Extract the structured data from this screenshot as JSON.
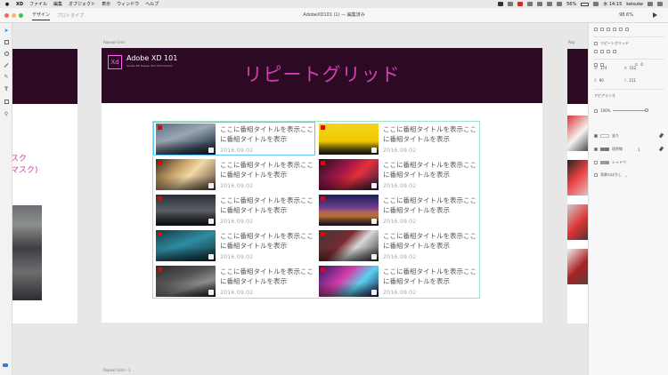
{
  "menubar": {
    "items": [
      "XD",
      "ファイル",
      "編集",
      "オブジェクト",
      "表示",
      "ウィンドウ",
      "ヘルプ"
    ],
    "battery": "56%",
    "clock": "水 14:15",
    "user": "keisuke"
  },
  "titlebar": {
    "tab_design": "デザイン",
    "tab_prototype": "プロトタイプ",
    "doc_title": "AdobeXD101 (1) — 編集済み",
    "zoom": "98.6%"
  },
  "canvas": {
    "label_main": "Repeat Grid",
    "label_right": "Rep",
    "label_bottom": "Repeat Grid – 1",
    "left_artboard_line1": "スク",
    "left_artboard_line2": "マスク)"
  },
  "artboard": {
    "logo": "Xd",
    "course_title": "Adobe XD 101",
    "course_subtitle": "Adobe XD Design Tool Introduction",
    "heading": "リピートグリッド"
  },
  "grid": {
    "items": [
      {
        "title": "ここに番組タイトルを表示ここに番組タイトルを表示",
        "date": "2016.09.02",
        "bg": "linear-gradient(160deg,#5d6d80 0%,#9aa6b3 40%,#3b4a5c 75%,#1f2833 100%)"
      },
      {
        "title": "ここに番組タイトルを表示ここに番組タイトルを表示",
        "date": "2016.09.02",
        "bg": "linear-gradient(180deg,#f5d51c 0%,#f0c800 60%,#222 100%)"
      },
      {
        "title": "ここに番組タイトルを表示ここに番組タイトルを表示",
        "date": "2016.09.02",
        "bg": "linear-gradient(135deg,#3a2a1f 0%,#c7a067 35%,#f1d9a8 55%,#5a4030 100%)"
      },
      {
        "title": "ここに番組タイトルを表示ここに番組タイトルを表示",
        "date": "2016.09.02",
        "bg": "linear-gradient(135deg,#1c1224 0%,#a4174a 40%,#e52f3a 60%,#26224a 100%)"
      },
      {
        "title": "ここに番組タイトルを表示ここに番組タイトルを表示",
        "date": "2016.09.02",
        "bg": "linear-gradient(180deg,#2a2d33 0%,#5a5e66 50%,#1b1c20 100%)"
      },
      {
        "title": "ここに番組タイトルを表示ここに番組タイトルを表示",
        "date": "2016.09.02",
        "bg": "linear-gradient(180deg,#1a1f5a 0%,#6a3b8a 40%,#e2873a 70%,#2a1840 100%)"
      },
      {
        "title": "ここに番組タイトルを表示ここに番組タイトルを表示",
        "date": "2016.09.02",
        "bg": "linear-gradient(160deg,#173a46 0%,#2e8ca0 45%,#0f2a34 100%)"
      },
      {
        "title": "ここに番組タイトルを表示ここに番組タイトルを表示",
        "date": "2016.09.02",
        "bg": "linear-gradient(135deg,#3a3a3a 0%,#7a2a30 40%,#d9d9d9 60%,#2a2a2a 100%)"
      },
      {
        "title": "ここに番組タイトルを表示ここに番組タイトルを表示",
        "date": "2016.09.02",
        "bg": "linear-gradient(160deg,#2c2c2c 0%,#555 40%,#8c8c8c 65%,#1e1e1e 100%)"
      },
      {
        "title": "ここに番組タイトルを表示ここに番組タイトルを表示",
        "date": "2016.09.02",
        "bg": "linear-gradient(135deg,#2a1a6a 0%,#d43ca8 40%,#5ad1f0 65%,#1a1440 100%)"
      }
    ]
  },
  "inspector": {
    "repeat_grid_button": "リピートグリッド",
    "rotate": "0",
    "w_label": "W",
    "w": "174",
    "h_label": "H",
    "h": "152",
    "x_label": "X",
    "x": "90",
    "y_label": "Y",
    "y": "211",
    "appearance_header": "アピアランス",
    "opacity": "100%",
    "fill_label": "塗り",
    "border_label": "境界線",
    "border_width": "1",
    "shadow_label": "シャドウ",
    "blur_label": "背景のぼかし"
  },
  "colors": {
    "header_bg": "#2d0a23",
    "accent_pink": "#d13fb0",
    "grid_outline": "#9fe3c7"
  }
}
